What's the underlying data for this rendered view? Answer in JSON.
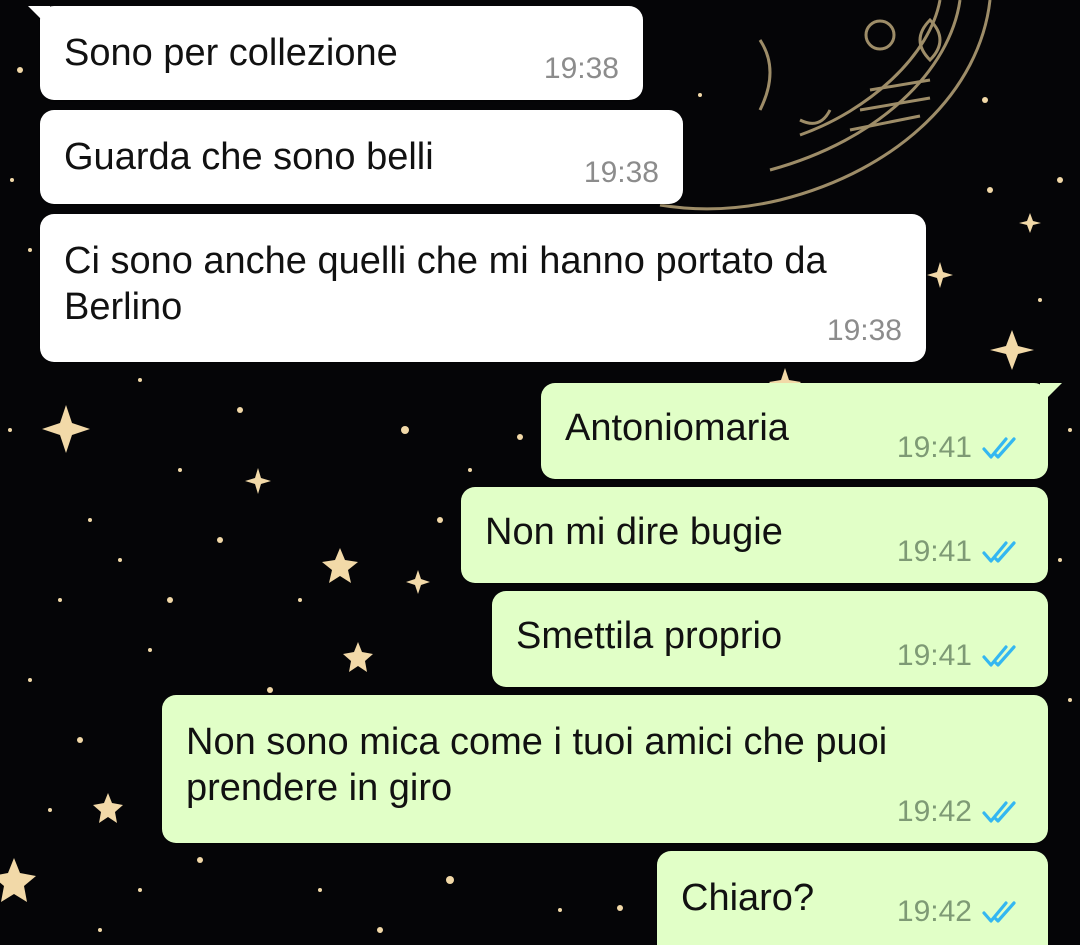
{
  "wallpaper": "starry-night-moon",
  "colors": {
    "incoming_bubble": "#ffffff",
    "outgoing_bubble": "#e1ffc7",
    "read_ticks": "#34b7f1",
    "background": "#050507"
  },
  "messages": [
    {
      "direction": "in",
      "text": "Sono per collezione",
      "time": "19:38"
    },
    {
      "direction": "in",
      "text": "Guarda che sono belli",
      "time": "19:38"
    },
    {
      "direction": "in",
      "text": "Ci sono anche quelli che mi hanno portato da Berlino",
      "time": "19:38"
    },
    {
      "direction": "out",
      "text": "Antoniomaria",
      "time": "19:41",
      "status": "read"
    },
    {
      "direction": "out",
      "text": "Non mi dire bugie",
      "time": "19:41",
      "status": "read"
    },
    {
      "direction": "out",
      "text": "Smettila proprio",
      "time": "19:41",
      "status": "read"
    },
    {
      "direction": "out",
      "text": "Non sono mica come i tuoi amici che puoi prendere in giro",
      "time": "19:42",
      "status": "read"
    },
    {
      "direction": "out",
      "text": "Chiaro?",
      "time": "19:42",
      "status": "read"
    }
  ]
}
